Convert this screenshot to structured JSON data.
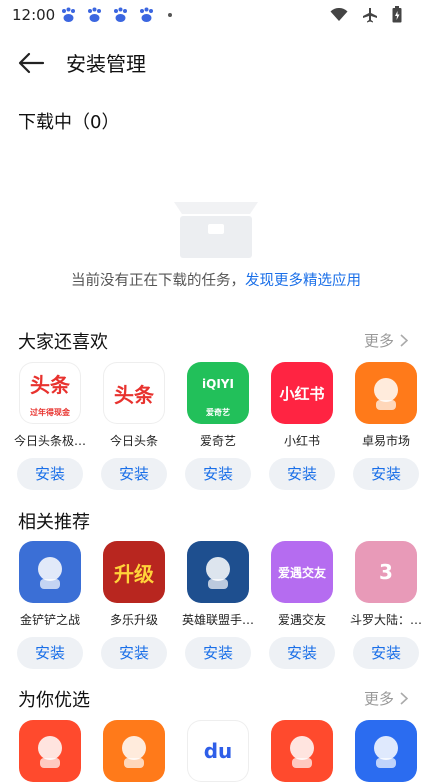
{
  "status_bar": {
    "time": "12:00"
  },
  "header": {
    "title": "安装管理"
  },
  "downloading": {
    "title": "下载中（0）",
    "empty_text": "当前没有正在下载的任务，",
    "empty_link": "发现更多精选应用"
  },
  "sections": [
    {
      "title": "大家还喜欢",
      "more": "更多",
      "apps": [
        {
          "name": "今日头条极…",
          "icon": "toutiao-lite-icon",
          "icon_text": "头条",
          "icon_sub": "过年得现金",
          "color": "#ffffff",
          "text_color": "#e8322e",
          "install": "安装"
        },
        {
          "name": "今日头条",
          "icon": "toutiao-icon",
          "icon_text": "头条",
          "icon_sub": "",
          "color": "#ffffff",
          "text_color": "#e8322e",
          "install": "安装"
        },
        {
          "name": "爱奇艺",
          "icon": "iqiyi-icon",
          "icon_text": "iQIYI",
          "icon_sub": "爱奇艺",
          "color": "#22c05a",
          "text_color": "#ffffff",
          "install": "安装"
        },
        {
          "name": "小红书",
          "icon": "xiaohongshu-icon",
          "icon_text": "小红书",
          "icon_sub": "",
          "color": "#ff2442",
          "text_color": "#ffffff",
          "install": "安装"
        },
        {
          "name": "卓易市场",
          "icon": "zhuoyi-market-icon",
          "icon_text": "",
          "icon_sub": "",
          "color": "#ff7a1a",
          "text_color": "#ffffff",
          "install": "安装"
        }
      ]
    },
    {
      "title": "相关推荐",
      "more": "",
      "apps": [
        {
          "name": "金铲铲之战",
          "icon": "jinchanchan-icon",
          "icon_text": "",
          "icon_sub": "",
          "color": "#3b6fd6",
          "text_color": "#ffffff",
          "install": "安装"
        },
        {
          "name": "多乐升级",
          "icon": "duole-shengji-icon",
          "icon_text": "升级",
          "icon_sub": "",
          "color": "#b8261f",
          "text_color": "#ffd33a",
          "install": "安装"
        },
        {
          "name": "英雄联盟手…",
          "icon": "lol-mobile-icon",
          "icon_text": "",
          "icon_sub": "",
          "color": "#1e4f8f",
          "text_color": "#ffffff",
          "install": "安装"
        },
        {
          "name": "爱遇交友",
          "icon": "aiyu-icon",
          "icon_text": "爱遇交友",
          "icon_sub": "",
          "color": "#b56cf0",
          "text_color": "#ffffff",
          "install": "安装"
        },
        {
          "name": "斗罗大陆：…",
          "icon": "douluo-icon",
          "icon_text": "3",
          "icon_sub": "",
          "color": "#e89ab8",
          "text_color": "#ffffff",
          "install": "安装"
        }
      ]
    },
    {
      "title": "为你优选",
      "more": "更多",
      "apps": [
        {
          "name": "",
          "icon": "kuaishou-icon",
          "icon_text": "",
          "icon_sub": "",
          "color": "#ff4a2d",
          "text_color": "#ffffff",
          "install": ""
        },
        {
          "name": "",
          "icon": "zhuoyi-market-icon",
          "icon_text": "",
          "icon_sub": "",
          "color": "#ff7a1a",
          "text_color": "#ffffff",
          "install": ""
        },
        {
          "name": "",
          "icon": "baidu-icon",
          "icon_text": "du",
          "icon_sub": "",
          "color": "#ffffff",
          "text_color": "#2e5ee8",
          "install": ""
        },
        {
          "name": "",
          "icon": "kuaishou-icon",
          "icon_text": "",
          "icon_sub": "",
          "color": "#ff4a2d",
          "text_color": "#ffffff",
          "install": ""
        },
        {
          "name": "",
          "icon": "weather-icon",
          "icon_text": "",
          "icon_sub": "",
          "color": "#2b6cf0",
          "text_color": "#ffffff",
          "install": ""
        }
      ]
    }
  ]
}
